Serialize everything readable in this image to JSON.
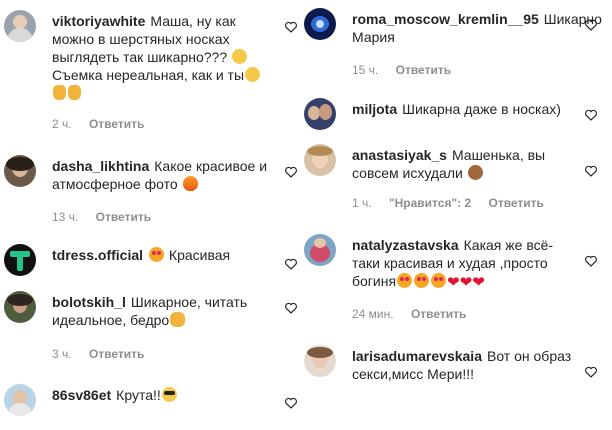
{
  "comments_left": [
    {
      "username": "viktoriyawhite",
      "text_parts": [
        "Маша, ну как можно в шерстяных носках выглядеть так шикарно??? ",
        {
          "emoji": "laugh"
        },
        " Съемка нереальная, как и ты",
        {
          "emoji": "wink"
        },
        " ",
        {
          "emoji": "thumb"
        },
        {
          "emoji": "thumb"
        }
      ],
      "time": "2 ч.",
      "reply": "Ответить"
    },
    {
      "username": "dasha_likhtina",
      "text_parts": [
        "Какое красивое и атмосферное фото ",
        {
          "emoji": "fire"
        }
      ],
      "time": "13 ч.",
      "reply": "Ответить"
    },
    {
      "username": "tdress.official",
      "text_parts": [
        {
          "emoji": "hearteyes"
        },
        " Красивая"
      ]
    },
    {
      "username": "bolotskih_l",
      "text_parts": [
        "Шикарное, читать идеальное, бедро",
        {
          "emoji": "clap"
        }
      ],
      "time": "3 ч.",
      "reply": "Ответить"
    },
    {
      "username": "86sv86et",
      "text_parts": [
        "Крута!!",
        {
          "emoji": "cool"
        }
      ]
    }
  ],
  "comments_right": [
    {
      "username": "roma_moscow_kremlin__95",
      "text_parts": [
        "Шикарно Мария"
      ],
      "time": "15 ч.",
      "reply": "Ответить"
    },
    {
      "username": "miljota",
      "text_parts": [
        "Шикарна даже в носках)"
      ]
    },
    {
      "username": "anastasiyak_s",
      "text_parts": [
        "Машенька, вы совсем исхудали ",
        {
          "emoji": "monkey"
        }
      ],
      "time": "1 ч.",
      "likes": "\"Нравится\": 2",
      "reply": "Ответить"
    },
    {
      "username": "natalyzastavska",
      "text_parts": [
        "Какая же всё-таки красивая и худая ,просто богиня",
        {
          "emoji": "hearteyes"
        },
        {
          "emoji": "hearteyes"
        },
        {
          "emoji": "hearteyes"
        },
        {
          "heart": "❤"
        },
        {
          "heart": "❤"
        },
        {
          "heart": "❤"
        }
      ],
      "time": "24 мин.",
      "reply": "Ответить"
    },
    {
      "username": "larisadumarevskaia",
      "text_parts": [
        "Вот он образ секси,мисс Мери!!!"
      ]
    }
  ],
  "icons": {
    "like": "heart-outline-icon"
  },
  "colors": {
    "text": "#262626",
    "meta": "#8e8e8e",
    "red_heart": "#e0142f"
  }
}
